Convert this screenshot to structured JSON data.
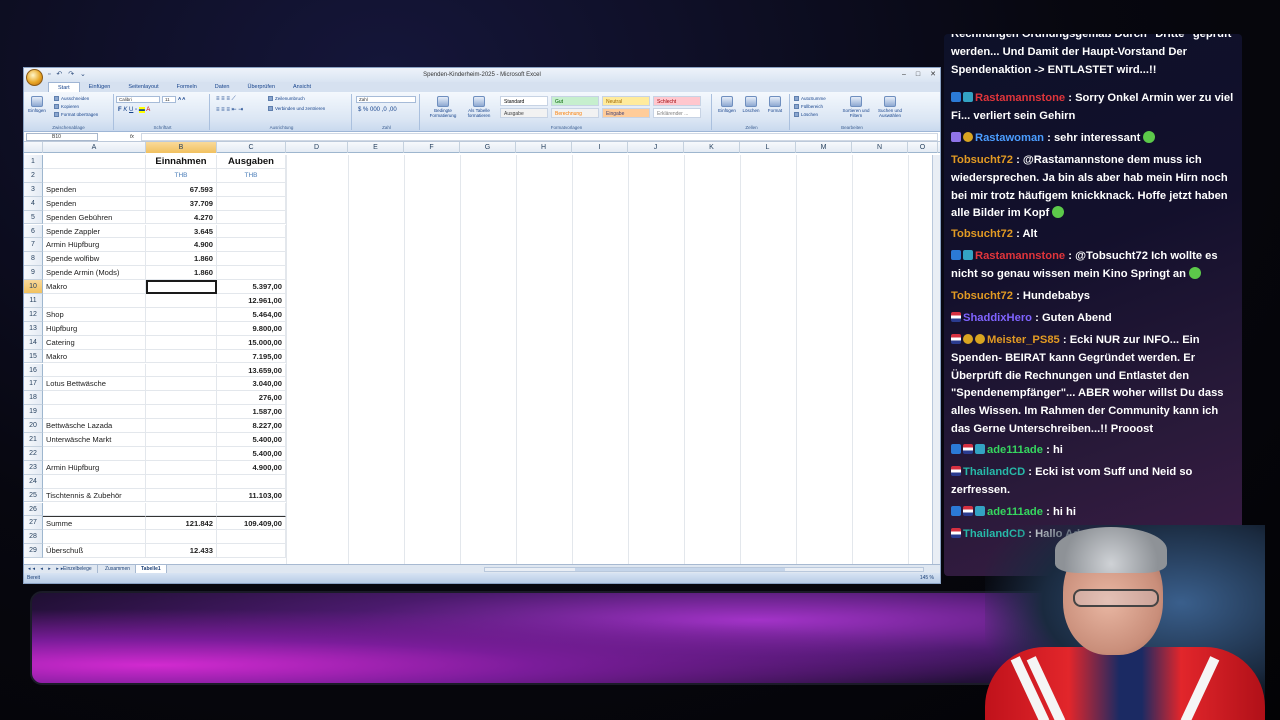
{
  "excel": {
    "window_title": "Spenden-Kinderheim-2025 - Microsoft Excel",
    "qat": "▫ ↶ ↷ ⌄",
    "window_controls": [
      "–",
      "□",
      "✕"
    ],
    "tabs": [
      "Start",
      "Einfügen",
      "Seitenlayout",
      "Formeln",
      "Daten",
      "Überprüfen",
      "Ansicht"
    ],
    "ribbon": {
      "paste": "Einfügen",
      "cut": "Ausschneiden",
      "copy": "Kopieren",
      "format_painter": "Format übertragen",
      "clipboard_group": "Zwischenablage",
      "font_name": "Calibri",
      "font_size": "11",
      "font_group": "Schriftart",
      "wrap": "Zeilenumbruch",
      "merge": "Verbinden und zentrieren",
      "align_group": "Ausrichtung",
      "number_format": "Zahl",
      "number_group": "Zahl",
      "cond_format": "Bedingte Formatierung",
      "table_format": "Als Tabelle formatieren",
      "styles_group": "Formatvorlagen",
      "styles": [
        {
          "label": "Standard",
          "bg": "#ffffff",
          "fg": "#000000"
        },
        {
          "label": "Gut",
          "bg": "#c6efce",
          "fg": "#006100"
        },
        {
          "label": "Neutral",
          "bg": "#ffeb9c",
          "fg": "#9c6500"
        },
        {
          "label": "Schlecht",
          "bg": "#ffc7ce",
          "fg": "#9c0006"
        },
        {
          "label": "Ausgabe",
          "bg": "#f2f2f2",
          "fg": "#3f3f3f"
        },
        {
          "label": "Berechnung",
          "bg": "#f2f2f2",
          "fg": "#fa7d00"
        },
        {
          "label": "Eingabe",
          "bg": "#ffcc99",
          "fg": "#3f3f76"
        },
        {
          "label": "Erklärender ...",
          "bg": "#ffffff",
          "fg": "#7f7f7f"
        }
      ],
      "insert_cells": "Einfügen",
      "delete_cells": "Löschen",
      "format_cells": "Format",
      "cells_group": "Zellen",
      "autosum": "AutoSumme",
      "fill": "Füllbereich",
      "clear": "Löschen",
      "sort": "Sortieren und Filtern",
      "find": "Suchen und Auswählen",
      "edit_group": "Bearbeiten"
    },
    "name_box": "B10",
    "fx": "fx",
    "columns": [
      "A",
      "B",
      "C",
      "D",
      "E",
      "F",
      "G",
      "H",
      "I",
      "J",
      "K",
      "L",
      "M",
      "N",
      "O"
    ],
    "rows": [
      {
        "n": "1",
        "a": "",
        "b": "Einnahmen",
        "c": "Ausgaben"
      },
      {
        "n": "2",
        "a": "",
        "b": "THB",
        "c": "THB"
      },
      {
        "n": "3",
        "a": "Spenden",
        "b": "67.593",
        "c": ""
      },
      {
        "n": "4",
        "a": "Spenden",
        "b": "37.709",
        "c": ""
      },
      {
        "n": "5",
        "a": "Spenden Gebühren",
        "b": "4.270",
        "c": ""
      },
      {
        "n": "6",
        "a": "Spende Zappler",
        "b": "3.645",
        "c": ""
      },
      {
        "n": "7",
        "a": "Armin Hüpfburg",
        "b": "4.900",
        "c": ""
      },
      {
        "n": "8",
        "a": "Spende wolfibw",
        "b": "1.860",
        "c": ""
      },
      {
        "n": "9",
        "a": "Spende Armin (Mods)",
        "b": "1.860",
        "c": ""
      },
      {
        "n": "10",
        "a": "Makro",
        "b": "",
        "c": "5.397,00"
      },
      {
        "n": "11",
        "a": "",
        "b": "",
        "c": "12.961,00"
      },
      {
        "n": "12",
        "a": "Shop",
        "b": "",
        "c": "5.464,00"
      },
      {
        "n": "13",
        "a": "Hüpfburg",
        "b": "",
        "c": "9.800,00"
      },
      {
        "n": "14",
        "a": "Catering",
        "b": "",
        "c": "15.000,00"
      },
      {
        "n": "15",
        "a": "Makro",
        "b": "",
        "c": "7.195,00"
      },
      {
        "n": "16",
        "a": "",
        "b": "",
        "c": "13.659,00"
      },
      {
        "n": "17",
        "a": "Lotus Bettwäsche",
        "b": "",
        "c": "3.040,00"
      },
      {
        "n": "18",
        "a": "",
        "b": "",
        "c": "276,00"
      },
      {
        "n": "19",
        "a": "",
        "b": "",
        "c": "1.587,00"
      },
      {
        "n": "20",
        "a": "Bettwäsche Lazada",
        "b": "",
        "c": "8.227,00"
      },
      {
        "n": "21",
        "a": "Unterwäsche Markt",
        "b": "",
        "c": "5.400,00"
      },
      {
        "n": "22",
        "a": "",
        "b": "",
        "c": "5.400,00"
      },
      {
        "n": "23",
        "a": "Armin Hüpfburg",
        "b": "",
        "c": "4.900,00"
      },
      {
        "n": "24",
        "a": "",
        "b": "",
        "c": ""
      },
      {
        "n": "25",
        "a": "Tischtennis & Zubehör",
        "b": "",
        "c": "11.103,00"
      },
      {
        "n": "26",
        "a": "",
        "b": "",
        "c": ""
      },
      {
        "n": "27",
        "a": "Summe",
        "b": "121.842",
        "c": "109.409,00"
      },
      {
        "n": "28",
        "a": "",
        "b": "",
        "c": ""
      },
      {
        "n": "29",
        "a": "Überschuß",
        "b": "12.433",
        "c": ""
      }
    ],
    "sheet_nav": "◂◂ ◂ ▸ ▸▸",
    "sheets": [
      "Einzelbelege",
      "Zusammen",
      "Tabelle1"
    ],
    "active_sheet": "Tabelle1",
    "status": "Bereit",
    "zoom": "145 %"
  },
  "chat": [
    {
      "badges": [],
      "user": "",
      "user_color": "",
      "text": "Rechnungen Ordnungsgemäß Durch \"Dritte\" geprüft werden... Und Damit der Haupt-Vorstand Der Spendenaktion -> ENTLASTET wird...!!"
    },
    {
      "badges": [
        "b-prime",
        "b-sub"
      ],
      "user": "Rastamannstone",
      "user_color": "u-red",
      "text": ": Sorry Onkel Armin wer zu viel Fi... verliert sein Gehirn"
    },
    {
      "badges": [
        "b-glitch",
        "b-gift"
      ],
      "user": "Rastawoman",
      "user_color": "u-blue",
      "text": ": sehr interessant",
      "emote": true
    },
    {
      "badges": [],
      "user": "Tobsucht72",
      "user_color": "u-orange",
      "text": ": @Rastamannstone dem muss ich wiedersprechen. Ja bin als aber hab mein Hirn noch bei mir trotz häufigem knickknack. Hoffe jetzt haben alle Bilder im Kopf",
      "emote": true
    },
    {
      "badges": [],
      "user": "Tobsucht72",
      "user_color": "u-orange",
      "text": ": Alt"
    },
    {
      "badges": [
        "b-prime",
        "b-sub"
      ],
      "user": "Rastamannstone",
      "user_color": "u-red",
      "text": ": @Tobsucht72 Ich wollte es nicht so genau wissen mein Kino Springt an",
      "emote": true
    },
    {
      "badges": [],
      "user": "Tobsucht72",
      "user_color": "u-orange",
      "text": ": Hundebabys"
    },
    {
      "badges": [
        "b-flag"
      ],
      "user": "ShaddixHero",
      "user_color": "u-purple",
      "text": ": Guten Abend"
    },
    {
      "badges": [
        "b-flag",
        "b-gift",
        "b-gift"
      ],
      "user": "Meister_PS85",
      "user_color": "u-orange",
      "text": ": Ecki NUR zur INFO... Ein Spenden- BEIRAT kann Gegründet werden. Er Überprüft die Rechnungen und Entlastet den \"Spendenempfänger\"... ABER woher willst Du dass alles Wissen. Im Rahmen der Community kann ich das Gerne Unterschreiben...!! Prooost"
    },
    {
      "badges": [
        "b-prime",
        "b-flag",
        "b-sub"
      ],
      "user": "ade111ade",
      "user_color": "u-green",
      "text": ": hi"
    },
    {
      "badges": [
        "b-flag"
      ],
      "user": "ThailandCD",
      "user_color": "u-teal",
      "text": ": Ecki ist vom Suff und Neid so zerfressen."
    },
    {
      "badges": [
        "b-prime",
        "b-flag",
        "b-sub"
      ],
      "user": "ade111ade",
      "user_color": "u-green",
      "text": ": hi hi"
    },
    {
      "badges": [
        "b-flag"
      ],
      "user": "ThailandCD",
      "user_color": "u-teal",
      "text": ": Hallo Ade"
    }
  ]
}
